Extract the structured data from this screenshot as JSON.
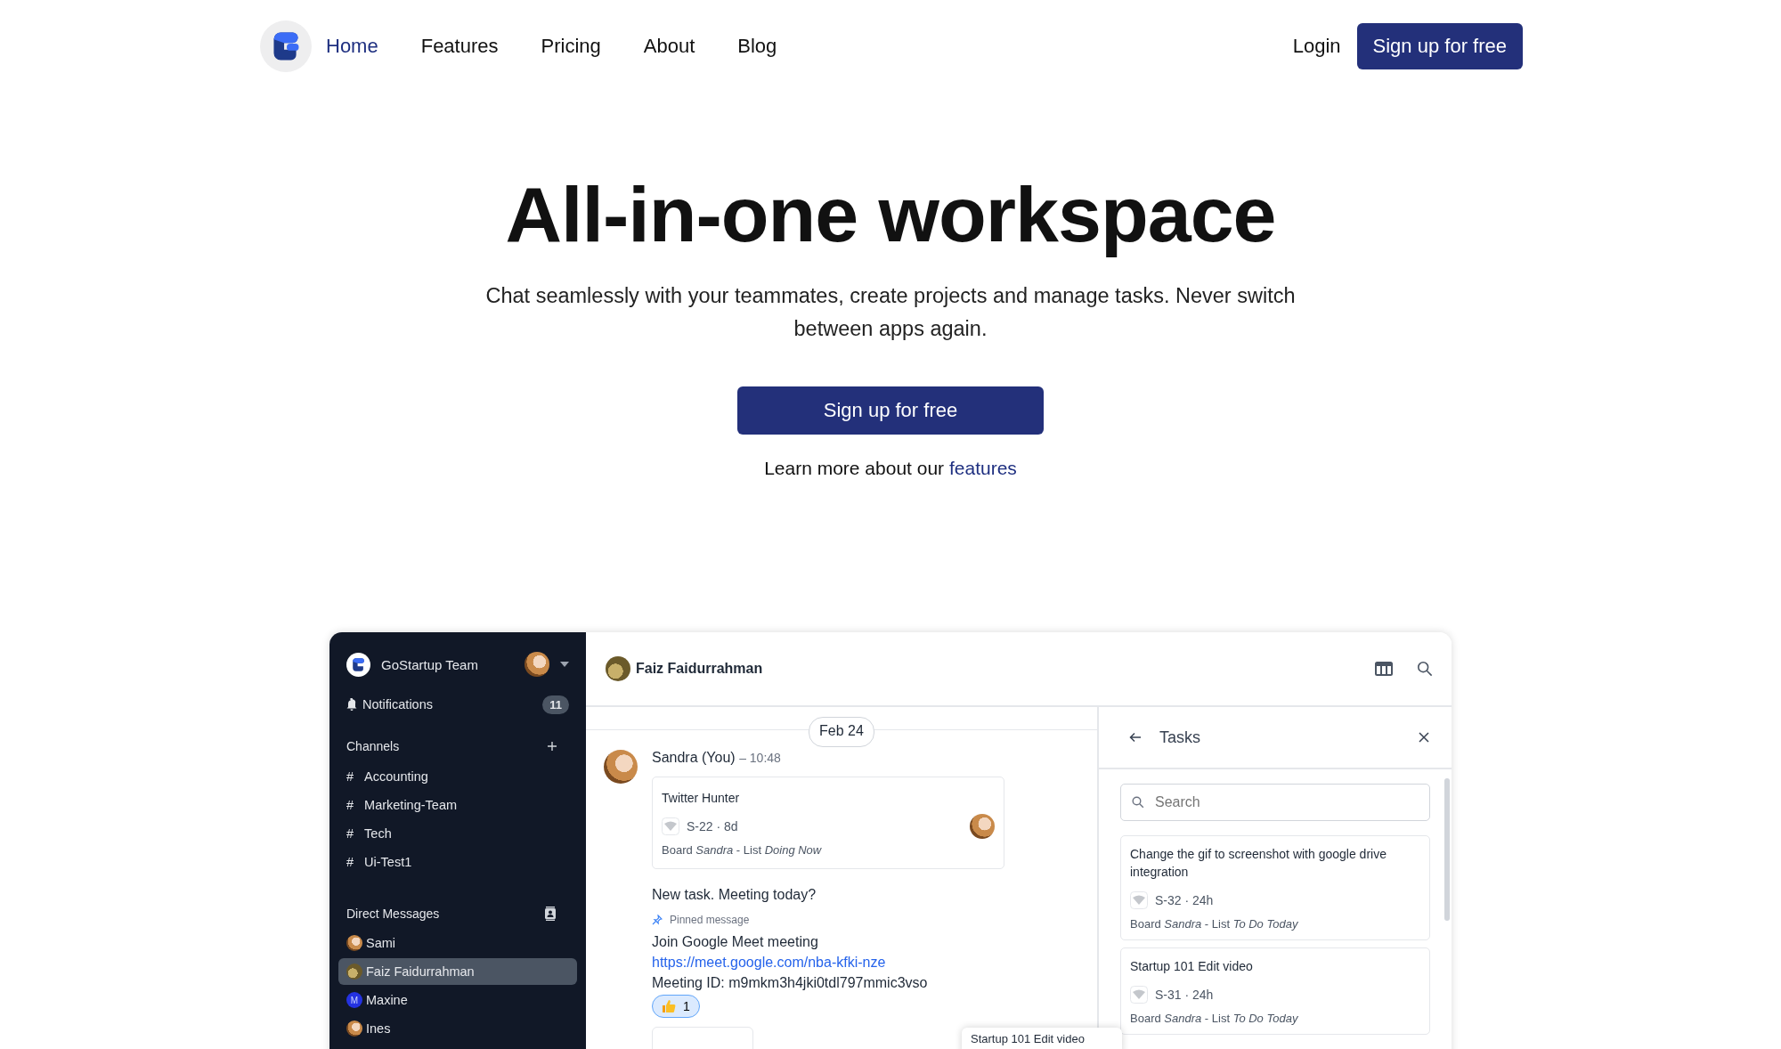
{
  "nav": {
    "links": [
      {
        "label": "Home",
        "selected": true
      },
      {
        "label": "Features",
        "selected": false
      },
      {
        "label": "Pricing",
        "selected": false
      },
      {
        "label": "About",
        "selected": false
      },
      {
        "label": "Blog",
        "selected": false
      }
    ],
    "login": "Login",
    "signup": "Sign up for free"
  },
  "hero": {
    "title": "All-in-one workspace",
    "subtitle": "Chat seamlessly with your teammates, create projects and manage tasks. Never switch between apps again.",
    "cta": "Sign up for free",
    "learn_more": {
      "text": "Learn more about our",
      "link": "features"
    }
  },
  "app": {
    "sidebar": {
      "team": "GoStartup Team",
      "notifications": {
        "label": "Notifications",
        "count": "11"
      },
      "channels_title": "Channels",
      "channels": [
        {
          "prefix": "#",
          "name": "Accounting"
        },
        {
          "prefix": "#",
          "name": "Marketing-Team"
        },
        {
          "prefix": "#",
          "name": "Tech"
        },
        {
          "prefix": "#",
          "name": "Ui-Test1"
        }
      ],
      "dm_title": "Direct Messages",
      "dms": [
        {
          "name": "Sami",
          "selected": false,
          "kind": "photo"
        },
        {
          "name": "Faiz Faidurrahman",
          "selected": true,
          "kind": "photo"
        },
        {
          "name": "Maxine",
          "selected": false,
          "kind": "initial",
          "initial": "M"
        },
        {
          "name": "Ines",
          "selected": false,
          "kind": "photo"
        }
      ]
    },
    "chat": {
      "contact": "Faiz Faidurrahman",
      "date": "Feb 24",
      "author": "Sandra (You)",
      "time": "– 10:48",
      "task": {
        "title": "Twitter Hunter",
        "meta": "S-22 · 8d",
        "board": "Board *Sandra* - List *Doing Now*"
      },
      "text": "New task. Meeting today?",
      "pinned": "Pinned message",
      "lines": [
        "Join Google Meet meeting"
      ],
      "link": "https://meet.google.com/nba-kfki-nze",
      "meeting_id": "Meeting ID: m9mkm3h4jki0tdl797mmic3vso",
      "reaction": {
        "count": "1",
        "selected": true
      }
    },
    "tasks": {
      "title": "Tasks",
      "search_placeholder": "Search",
      "cards": [
        {
          "title": "Change the gif to screenshot with google drive integration",
          "meta": "S-32 · 24h",
          "board": "Board *Sandra* - List *To Do Today*"
        },
        {
          "title": "Startup 101 Edit video",
          "meta": "S-31 · 24h",
          "board": "Board *Sandra* - List *To Do Today*"
        }
      ],
      "dragged_card": "Startup 101 Edit video"
    }
  }
}
